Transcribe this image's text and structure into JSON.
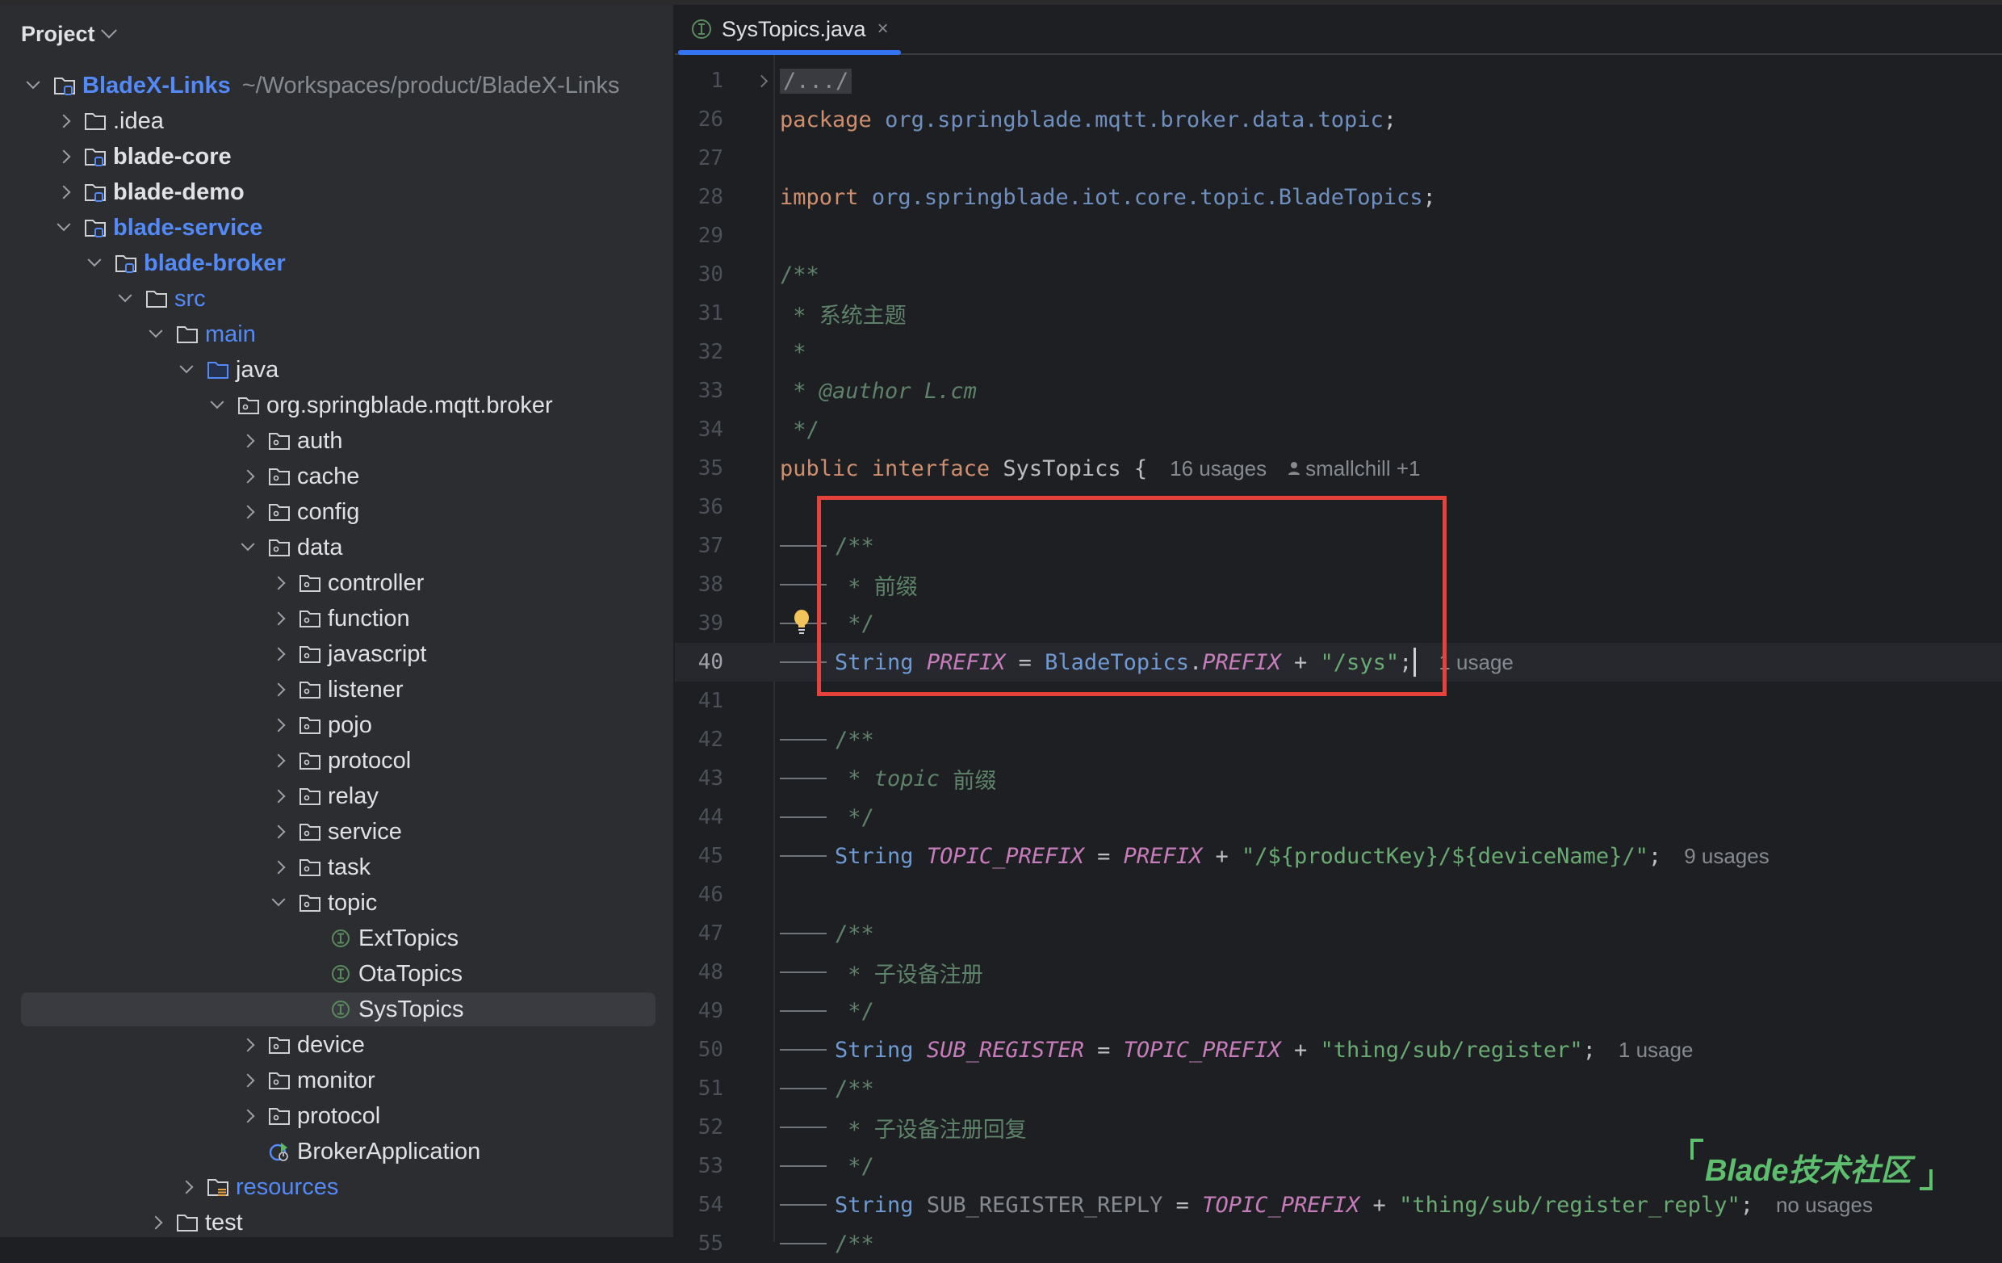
{
  "sidebar": {
    "title": "Project",
    "tree": [
      {
        "label": "BladeX-Links",
        "path": "~/Workspaces/product/BladeX-Links",
        "level": 0,
        "arrow": "down",
        "icon": "module-folder",
        "style": "bold blue"
      },
      {
        "label": ".idea",
        "level": 1,
        "arrow": "right",
        "icon": "folder",
        "style": ""
      },
      {
        "label": "blade-core",
        "level": 1,
        "arrow": "right",
        "icon": "module-folder",
        "style": "bold"
      },
      {
        "label": "blade-demo",
        "level": 1,
        "arrow": "right",
        "icon": "module-folder",
        "style": "bold"
      },
      {
        "label": "blade-service",
        "level": 1,
        "arrow": "down",
        "icon": "module-folder",
        "style": "bold blue"
      },
      {
        "label": "blade-broker",
        "level": 2,
        "arrow": "down",
        "icon": "module-folder",
        "style": "bold blue"
      },
      {
        "label": "src",
        "level": 3,
        "arrow": "down",
        "icon": "folder",
        "style": "blue"
      },
      {
        "label": "main",
        "level": 4,
        "arrow": "down",
        "icon": "folder",
        "style": "blue"
      },
      {
        "label": "java",
        "level": 5,
        "arrow": "down",
        "icon": "source-folder",
        "style": ""
      },
      {
        "label": "org.springblade.mqtt.broker",
        "level": 6,
        "arrow": "down",
        "icon": "package",
        "style": ""
      },
      {
        "label": "auth",
        "level": 7,
        "arrow": "right",
        "icon": "package",
        "style": ""
      },
      {
        "label": "cache",
        "level": 7,
        "arrow": "right",
        "icon": "package",
        "style": ""
      },
      {
        "label": "config",
        "level": 7,
        "arrow": "right",
        "icon": "package",
        "style": ""
      },
      {
        "label": "data",
        "level": 7,
        "arrow": "down",
        "icon": "package",
        "style": ""
      },
      {
        "label": "controller",
        "level": 8,
        "arrow": "right",
        "icon": "package",
        "style": ""
      },
      {
        "label": "function",
        "level": 8,
        "arrow": "right",
        "icon": "package",
        "style": ""
      },
      {
        "label": "javascript",
        "level": 8,
        "arrow": "right",
        "icon": "package",
        "style": ""
      },
      {
        "label": "listener",
        "level": 8,
        "arrow": "right",
        "icon": "package",
        "style": ""
      },
      {
        "label": "pojo",
        "level": 8,
        "arrow": "right",
        "icon": "package",
        "style": ""
      },
      {
        "label": "protocol",
        "level": 8,
        "arrow": "right",
        "icon": "package",
        "style": ""
      },
      {
        "label": "relay",
        "level": 8,
        "arrow": "right",
        "icon": "package",
        "style": ""
      },
      {
        "label": "service",
        "level": 8,
        "arrow": "right",
        "icon": "package",
        "style": ""
      },
      {
        "label": "task",
        "level": 8,
        "arrow": "right",
        "icon": "package",
        "style": ""
      },
      {
        "label": "topic",
        "level": 8,
        "arrow": "down",
        "icon": "package",
        "style": ""
      },
      {
        "label": "ExtTopics",
        "level": 9,
        "arrow": "none",
        "icon": "interface",
        "style": ""
      },
      {
        "label": "OtaTopics",
        "level": 9,
        "arrow": "none",
        "icon": "interface",
        "style": ""
      },
      {
        "label": "SysTopics",
        "level": 9,
        "arrow": "none",
        "icon": "interface",
        "style": "",
        "selected": true
      },
      {
        "label": "device",
        "level": 7,
        "arrow": "right",
        "icon": "package",
        "style": ""
      },
      {
        "label": "monitor",
        "level": 7,
        "arrow": "right",
        "icon": "package",
        "style": ""
      },
      {
        "label": "protocol",
        "level": 7,
        "arrow": "right",
        "icon": "package",
        "style": ""
      },
      {
        "label": "BrokerApplication",
        "level": 7,
        "arrow": "none",
        "icon": "spring-boot-app",
        "style": ""
      },
      {
        "label": "resources",
        "level": 5,
        "arrow": "right",
        "icon": "resources-folder",
        "style": "blue"
      },
      {
        "label": "test",
        "level": 4,
        "arrow": "right",
        "icon": "folder",
        "style": ""
      }
    ]
  },
  "editor": {
    "tab": {
      "title": "SysTopics.java",
      "icon": "interface-icon",
      "close": "×"
    },
    "lines": [
      {
        "n": "1",
        "fold": true,
        "tokens": [
          [
            "folded",
            "/.../"
          ]
        ]
      },
      {
        "n": "26",
        "tokens": [
          [
            "kw",
            "package"
          ],
          [
            "plain",
            " "
          ],
          [
            "pkg",
            "org.springblade.mqtt.broker.data.topic"
          ],
          [
            "plain",
            ";"
          ]
        ]
      },
      {
        "n": "27",
        "tokens": []
      },
      {
        "n": "28",
        "tokens": [
          [
            "kw",
            "import"
          ],
          [
            "plain",
            " "
          ],
          [
            "pkg",
            "org.springblade.iot.core.topic.BladeTopics"
          ],
          [
            "plain",
            ";"
          ]
        ]
      },
      {
        "n": "29",
        "tokens": []
      },
      {
        "n": "30",
        "tokens": [
          [
            "cm",
            "/**"
          ]
        ]
      },
      {
        "n": "31",
        "tokens": [
          [
            "cm",
            " * 系统主题"
          ]
        ]
      },
      {
        "n": "32",
        "tokens": [
          [
            "cm",
            " *"
          ]
        ]
      },
      {
        "n": "33",
        "tokens": [
          [
            "cm",
            " * "
          ],
          [
            "cmi",
            "@author"
          ],
          [
            "cm",
            " "
          ],
          [
            "cmi",
            "L.cm"
          ]
        ]
      },
      {
        "n": "34",
        "tokens": [
          [
            "cm",
            " */"
          ]
        ]
      },
      {
        "n": "35",
        "tokens": [
          [
            "kw",
            "public interface "
          ],
          [
            "plain",
            "SysTopics {"
          ]
        ],
        "hint": "16 usages",
        "author": "smallchill +1"
      },
      {
        "n": "36",
        "tokens": []
      },
      {
        "n": "37",
        "indent": true,
        "tokens": [
          [
            "cm",
            "/**"
          ]
        ]
      },
      {
        "n": "38",
        "indent": true,
        "tokens": [
          [
            "cm",
            " * 前缀"
          ]
        ]
      },
      {
        "n": "39",
        "indent": true,
        "bulb": true,
        "tokens": [
          [
            "cm",
            " */"
          ]
        ]
      },
      {
        "n": "40",
        "indent": true,
        "current": true,
        "caret": true,
        "tokens": [
          [
            "typ",
            "String"
          ],
          [
            "plain",
            " "
          ],
          [
            "cst",
            "PREFIX"
          ],
          [
            "plain",
            " = "
          ],
          [
            "cls",
            "BladeTopics"
          ],
          [
            "plain",
            "."
          ],
          [
            "cst",
            "PREFIX"
          ],
          [
            "plain",
            " + "
          ],
          [
            "str",
            "\"/sys\""
          ],
          [
            "plain",
            ";"
          ]
        ],
        "hint": "1 usage"
      },
      {
        "n": "41",
        "tokens": []
      },
      {
        "n": "42",
        "indent": true,
        "tokens": [
          [
            "cm",
            "/**"
          ]
        ]
      },
      {
        "n": "43",
        "indent": true,
        "tokens": [
          [
            "cm",
            " * "
          ],
          [
            "cmi",
            "topic"
          ],
          [
            "cm",
            " 前缀"
          ]
        ]
      },
      {
        "n": "44",
        "indent": true,
        "tokens": [
          [
            "cm",
            " */"
          ]
        ]
      },
      {
        "n": "45",
        "indent": true,
        "tokens": [
          [
            "typ",
            "String"
          ],
          [
            "plain",
            " "
          ],
          [
            "cst",
            "TOPIC_PREFIX"
          ],
          [
            "plain",
            " = "
          ],
          [
            "cst",
            "PREFIX"
          ],
          [
            "plain",
            " + "
          ],
          [
            "str",
            "\"/${productKey}/${deviceName}/\""
          ],
          [
            "plain",
            ";"
          ]
        ],
        "hint": "9 usages"
      },
      {
        "n": "46",
        "tokens": []
      },
      {
        "n": "47",
        "indent": true,
        "tokens": [
          [
            "cm",
            "/**"
          ]
        ]
      },
      {
        "n": "48",
        "indent": true,
        "tokens": [
          [
            "cm",
            " * 子设备注册"
          ]
        ]
      },
      {
        "n": "49",
        "indent": true,
        "tokens": [
          [
            "cm",
            " */"
          ]
        ]
      },
      {
        "n": "50",
        "indent": true,
        "tokens": [
          [
            "typ",
            "String"
          ],
          [
            "plain",
            " "
          ],
          [
            "cst",
            "SUB_REGISTER"
          ],
          [
            "plain",
            " = "
          ],
          [
            "cst",
            "TOPIC_PREFIX"
          ],
          [
            "plain",
            " + "
          ],
          [
            "str",
            "\"thing/sub/register\""
          ],
          [
            "plain",
            ";"
          ]
        ],
        "hint": "1 usage"
      },
      {
        "n": "51",
        "indent": true,
        "tokens": [
          [
            "cm",
            "/**"
          ]
        ]
      },
      {
        "n": "52",
        "indent": true,
        "tokens": [
          [
            "cm",
            " * 子设备注册回复"
          ]
        ]
      },
      {
        "n": "53",
        "indent": true,
        "tokens": [
          [
            "cm",
            " */"
          ]
        ]
      },
      {
        "n": "54",
        "indent": true,
        "tokens": [
          [
            "typ",
            "String"
          ],
          [
            "plain",
            " "
          ],
          [
            "dim",
            "SUB_REGISTER_REPLY"
          ],
          [
            "plain",
            " = "
          ],
          [
            "cst",
            "TOPIC_PREFIX"
          ],
          [
            "plain",
            " + "
          ],
          [
            "str",
            "\"thing/sub/register_reply\""
          ],
          [
            "plain",
            ";"
          ]
        ],
        "hint": "no usages"
      },
      {
        "n": "55",
        "indent": true,
        "tokens": [
          [
            "cm",
            "/**"
          ]
        ]
      }
    ]
  },
  "watermark": {
    "text": "Blade技术社区"
  },
  "colors": {
    "accent": "#3574f0",
    "highlight_box": "#e5423c",
    "watermark": "#5dbf6e"
  }
}
